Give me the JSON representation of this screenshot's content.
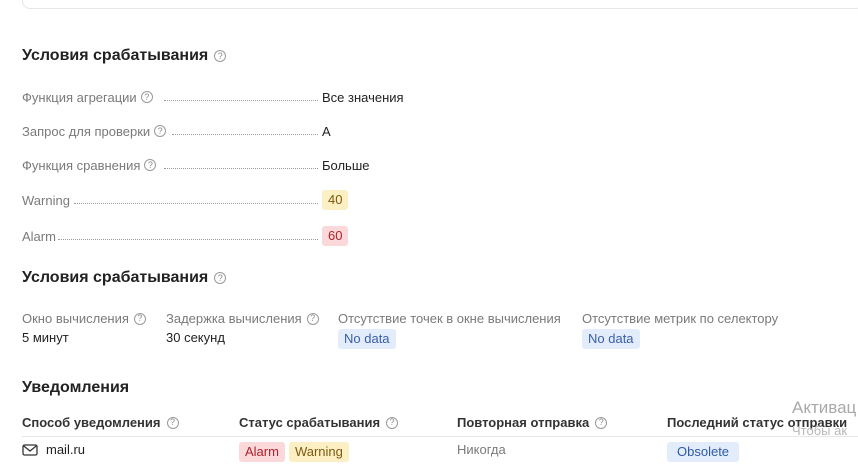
{
  "trigger_conditions": {
    "title": "Условия срабатывания",
    "rows": [
      {
        "label": "Функция агрегации",
        "value": "Все значения"
      },
      {
        "label": "Запрос для проверки",
        "value": "A"
      },
      {
        "label": "Функция сравнения",
        "value": "Больше"
      },
      {
        "label": "Warning",
        "value": "40",
        "badge": "warning"
      },
      {
        "label": "Alarm",
        "value": "60",
        "badge": "alarm"
      }
    ]
  },
  "evaluation": {
    "title": "Условия срабатывания",
    "columns": [
      {
        "label": "Окно вычисления",
        "value": "5 минут"
      },
      {
        "label": "Задержка вычисления",
        "value": "30 секунд"
      },
      {
        "label": "Отсутствие точек в окне вычисления",
        "value": "No data"
      },
      {
        "label": "Отсутствие метрик по селектору",
        "value": "No data"
      }
    ]
  },
  "notifications": {
    "title": "Уведомления",
    "headers": {
      "method": "Способ уведомления",
      "status": "Статус срабатывания",
      "repeat": "Повторная отправка",
      "last_status": "Последний статус отправки"
    },
    "row": {
      "method": "mail.ru",
      "statuses": [
        "Alarm",
        "Warning"
      ],
      "repeat": "Никогда",
      "last_status": "Obsolete"
    }
  },
  "activation_watermark": {
    "line1": "Активац",
    "line2": "Чтобы ак"
  },
  "colors": {
    "warning_bg": "#fdefc4",
    "alarm_bg": "#fbd9da",
    "info_bg": "#e3ecfb"
  }
}
